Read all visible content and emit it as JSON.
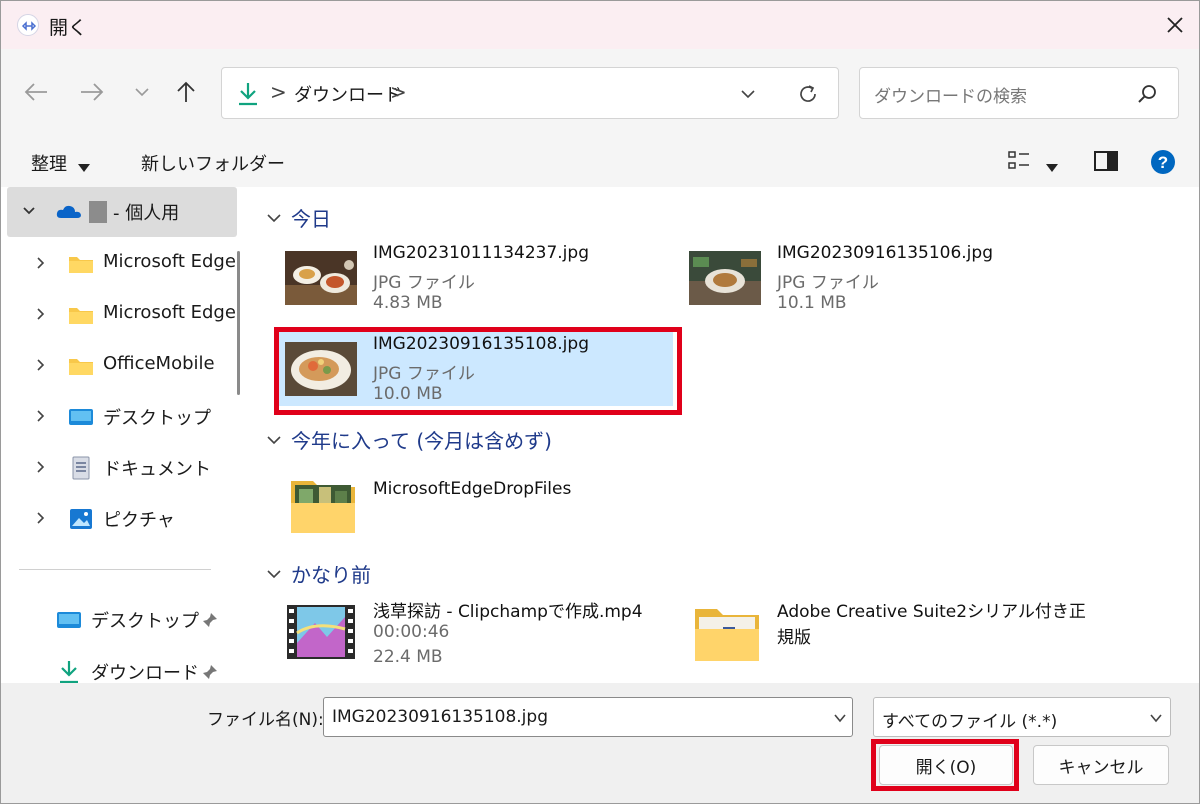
{
  "window": {
    "title": "開く"
  },
  "navigation": {
    "address_crumbs": [
      "ダウンロード"
    ],
    "separator": ">",
    "search_placeholder": "ダウンロードの検索"
  },
  "toolbar": {
    "organize_label": "整理",
    "new_folder_label": "新しいフォルダー"
  },
  "sidebar": {
    "items": [
      {
        "label": "- 個人用",
        "icon": "onedrive-cloud-icon",
        "expanded": true,
        "selected": true
      },
      {
        "label": "Microsoft Edge",
        "icon": "folder-icon"
      },
      {
        "label": "Microsoft Edge",
        "icon": "folder-icon"
      },
      {
        "label": "OfficeMobile",
        "icon": "folder-icon"
      },
      {
        "label": "デスクトップ",
        "icon": "desktop-icon"
      },
      {
        "label": "ドキュメント",
        "icon": "documents-icon"
      },
      {
        "label": "ピクチャ",
        "icon": "pictures-icon"
      }
    ],
    "pinned": [
      {
        "label": "デスクトップ",
        "icon": "desktop-icon"
      },
      {
        "label": "ダウンロード",
        "icon": "download-icon"
      }
    ]
  },
  "content": {
    "groups": [
      {
        "header": "今日",
        "files": [
          {
            "name": "IMG20231011134237.jpg",
            "type": "JPG ファイル",
            "size": "4.83 MB"
          },
          {
            "name": "IMG20230916135106.jpg",
            "type": "JPG ファイル",
            "size": "10.1 MB"
          },
          {
            "name": "IMG20230916135108.jpg",
            "type": "JPG ファイル",
            "size": "10.0 MB",
            "selected": true
          }
        ]
      },
      {
        "header": "今年に入って (今月は含めず)",
        "files": [
          {
            "name": "MicrosoftEdgeDropFiles",
            "kind": "folder"
          }
        ]
      },
      {
        "header": "かなり前",
        "files": [
          {
            "name": "浅草探訪 - Clipchampで作成.mp4",
            "duration": "00:00:46",
            "size": "22.4 MB",
            "kind": "video"
          },
          {
            "name": "Adobe Creative Suite2シリアル付き正",
            "name_line2": "規版",
            "kind": "folder"
          }
        ]
      }
    ]
  },
  "footer": {
    "filename_label": "ファイル名(N):",
    "filename_value": "IMG20230916135108.jpg",
    "filetype_value": "すべてのファイル (*.*)",
    "open_label": "開く(O)",
    "cancel_label": "キャンセル"
  },
  "colors": {
    "accent": "#0067c0",
    "selection": "#cce8ff",
    "highlight_box": "#e0001a",
    "group_header": "#1f3a8a"
  }
}
